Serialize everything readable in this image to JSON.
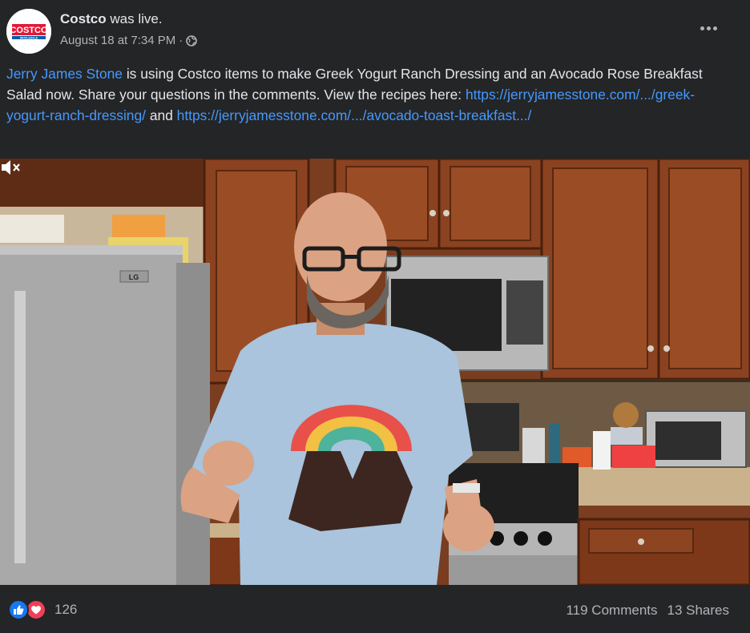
{
  "header": {
    "page_name": "Costco",
    "live_text": "was live.",
    "timestamp": "August 18 at 7:34 PM",
    "separator": "·",
    "privacy_icon": "globe-icon",
    "more_icon": "more-options-icon"
  },
  "avatar": {
    "logo_text": "COSTCO",
    "logo_subtext": "WHOLESALE"
  },
  "description": {
    "author_link": "Jerry James Stone",
    "text_1": " is using Costco items to make Greek Yogurt Ranch Dressing and an Avocado Rose Breakfast Salad now. Share your questions in the comments. View the recipes here: ",
    "link_1": "https://jerryjamesstone.com/.../greek-yogurt-ranch-dressing/",
    "text_2": " and ",
    "link_2": "https://jerryjamesstone.com/.../avocado-toast-breakfast.../"
  },
  "video": {
    "appliance_brand": "LG",
    "mute_icon": "speaker-muted-icon"
  },
  "footer": {
    "like_icon": "like-reaction-icon",
    "love_icon": "love-reaction-icon",
    "reaction_count": "126",
    "comments": "119 Comments",
    "shares": "13 Shares"
  },
  "colors": {
    "background": "#242526",
    "link": "#4599ff",
    "text_primary": "#e4e6eb",
    "text_secondary": "#b0b3b8",
    "like_blue": "#1877f2",
    "love_red": "#f33e58",
    "costco_red": "#e31837",
    "costco_blue": "#005daa"
  }
}
